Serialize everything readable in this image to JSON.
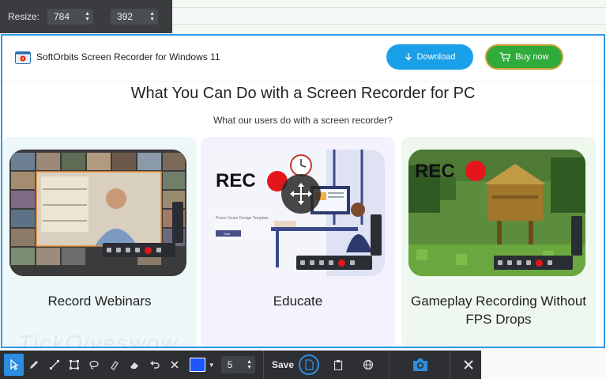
{
  "resize": {
    "label": "Resize:",
    "width": "784",
    "height": "392"
  },
  "site": {
    "brand": "SoftOrbits Screen Recorder for Windows 11",
    "download_label": "Download",
    "buy_label": "Buy now",
    "headline": "What You Can Do with a Screen Recorder for PC",
    "subhead": "What our users do with a screen recorder?"
  },
  "cards": [
    {
      "title": "Record Webinars"
    },
    {
      "title": "Educate",
      "rec": "REC",
      "slide_text": "Power Scam Design Template",
      "slide_button": "Start"
    },
    {
      "title": "Gameplay Recording Without FPS Drops",
      "rec": "REC"
    }
  ],
  "watermark": "TickOiveswow",
  "toolbar": {
    "stroke_width": "5",
    "save_label": "Save",
    "color": "#1d55ff"
  },
  "colors": {
    "accent": "#2d9be6",
    "download": "#1aa0e8",
    "buy": "#2eab3a",
    "rec_dot": "#e5161b"
  }
}
